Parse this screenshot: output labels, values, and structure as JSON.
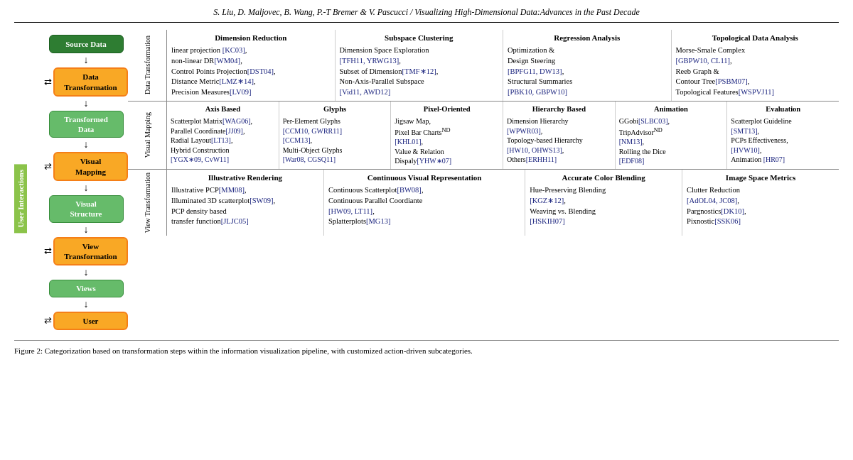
{
  "header": {
    "text": "S. Liu, D. Maljovec, B. Wang, P.-T Bremer & V. Pascucci / Visualizing High-Dimensional Data:Advances in the Past Decade"
  },
  "flowchart": {
    "boxes": [
      {
        "label": "Source Data",
        "type": "green-dark"
      },
      {
        "label": "Data\nTransformation",
        "type": "yellow"
      },
      {
        "label": "Transformed\nData",
        "type": "green-light"
      },
      {
        "label": "Visual\nMapping",
        "type": "yellow"
      },
      {
        "label": "Visual\nStructure",
        "type": "green-light"
      },
      {
        "label": "View\nTransformation",
        "type": "yellow"
      },
      {
        "label": "Views",
        "type": "green-light"
      },
      {
        "label": "User",
        "type": "yellow"
      }
    ],
    "user_interactions": "User Interactions"
  },
  "sections": [
    {
      "label": "Data Transformation",
      "categories": [
        {
          "title": "Dimension Reduction",
          "content": "linear projection [KC03],\nnon-linear DR[WM04],\nControl Points Projection[DST04],\nDistance Metric[LMZ*14],\nPrecision Measures[LV09]"
        },
        {
          "title": "Subspace Clustering",
          "content": "Dimension Space Exploration\n[TFH11, YRWG13],\nSubset of Dimension[TMF*12],\nNon-Axis-Parallel Subspace\n[Vid11, AWD12]"
        },
        {
          "title": "Regression Analysis",
          "content": "Optimization &\nDesign Steering\n[BPFG11, DW13],\nStructural Summaries\n[PBK10, GBPW10]"
        },
        {
          "title": "Topological Data Analysis",
          "content": "Morse-Smale Complex\n[GBPW10, CL11],\nReeb Graph &\nContour Tree[PSBM07],\nTopological Features[WSPVJ11]"
        }
      ]
    },
    {
      "label": "Visual Mapping",
      "categories": [
        {
          "title": "Axis Based",
          "content": "Scatterplot Matrix[WAG06],\nParallel Coordinate[JJ09],\nRadial Layout[LT13],\nHybrid Construction\n[YGX*09, CvW11]"
        },
        {
          "title": "Glyphs",
          "content": "Per-Element Glyphs\n[CCM10, GWRR11]\n[CCM13],\nMulti-Object Glyphs\n[War08, CGSQ11]"
        },
        {
          "title": "Pixel-Oriented",
          "content": "Jigsaw Map,\nPixel Bar Charts\n[KHL01],\nValue & Relation\nDispalyDisplay[YHW*07]"
        },
        {
          "title": "Hierarchy Based",
          "content": "Dimension Hierarchy\n[WPWR03],\nTopology-based Hierarchy\n[HW10, OHWS13],\nOthers[ERHH11]"
        },
        {
          "title": "Animation",
          "content": "GGobi[SLBC03],\nTripAdvisor^ND\n[NM13],\nRolling the Dice\n[EDF08]"
        },
        {
          "title": "Evaluation",
          "content": "Scatterplot Guideline\n[SMT13],\nPCPs Effectiveness,\n[HVW10],\nAnimation [HR07]"
        }
      ]
    },
    {
      "label": "View Transformation",
      "categories": [
        {
          "title": "Illustrative Rendering",
          "content": "Illustrative PCP[MM08],\nIlluminated 3D scatterplot[SW09],\nPCP density based\ntransfer function[JLJC05]"
        },
        {
          "title": "Continuous Visual Representation",
          "content": "Continuous Scatterplot[BW08],\nContinuous Parallel Coordiante\n[HW09, LT11],\nSplatterplots[MG13]"
        },
        {
          "title": "Accurate Color Blending",
          "content": "Hue-Preserving Blending\n[KGZ*12],\nWeaving vs. Blending\n[HSKIH07]"
        },
        {
          "title": "Image Space Metrics",
          "content": "Clutter Reduction\n[AdOL04, JC08],\nPargnostics[DK10],\nPixnostic[SSK06]"
        }
      ]
    }
  ],
  "caption": {
    "text": "Figure 2: Categorization based on transformation steps within the information visualization pipeline, with customized action-driven subcategories."
  }
}
